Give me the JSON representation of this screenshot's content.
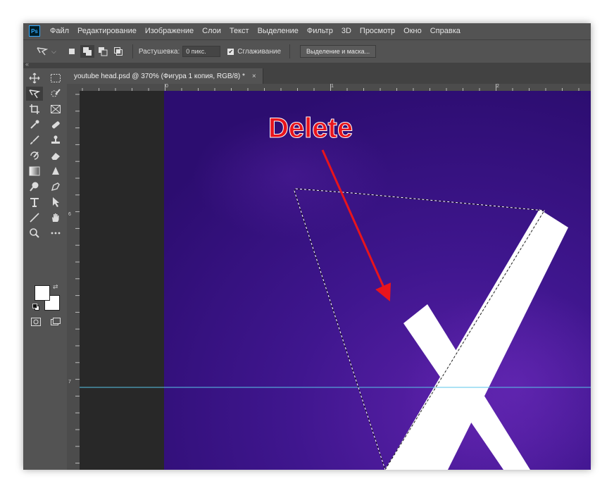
{
  "app": {
    "logo": "Ps"
  },
  "menu": [
    "Файл",
    "Редактирование",
    "Изображение",
    "Слои",
    "Текст",
    "Выделение",
    "Фильтр",
    "3D",
    "Просмотр",
    "Окно",
    "Справка"
  ],
  "options": {
    "tool_icon": "polygonal-lasso-icon",
    "feather_label": "Растушевка:",
    "feather_value": "0 пикс.",
    "antialias_label": "Сглаживание",
    "antialias_checked": true,
    "select_mask_label": "Выделение и маска..."
  },
  "document": {
    "tab_title": "youtube head.psd @ 370% (Фигура 1 копия, RGB/8) *",
    "close_glyph": "×"
  },
  "rulers": {
    "top": [
      "0",
      "1",
      "2"
    ],
    "left": [
      "6",
      "7"
    ]
  },
  "annotation": {
    "label": "Delete",
    "color": "#e8141c"
  },
  "colors": {
    "canvas_purple": "#3a1484",
    "guide": "#58c6e8",
    "foreground": "#ffffff",
    "background": "#ffffff"
  }
}
